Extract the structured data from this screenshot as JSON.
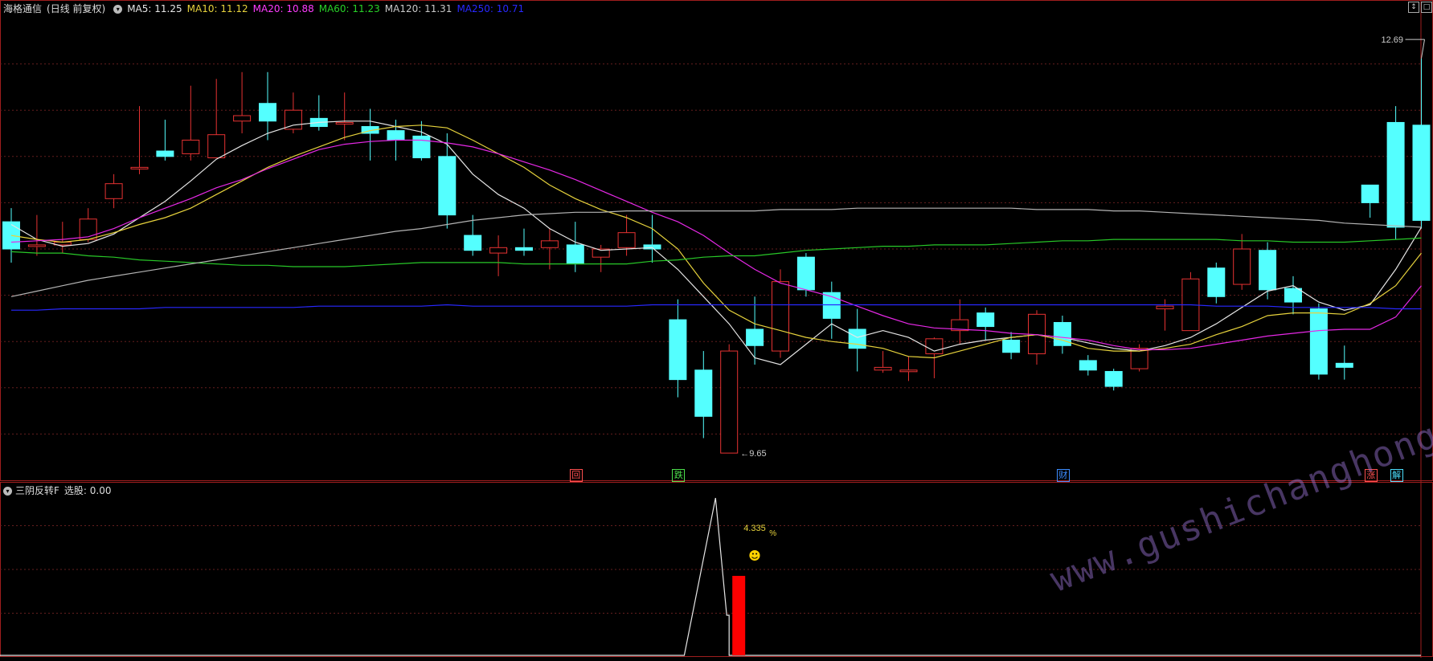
{
  "header": {
    "stock": "海格通信",
    "period": "(日线 前复权)",
    "ma": [
      {
        "label": "MA5: 11.25",
        "color": "#e6e6e6"
      },
      {
        "label": "MA10: 11.12",
        "color": "#e6d23c"
      },
      {
        "label": "MA20: 10.88",
        "color": "#ff3cff"
      },
      {
        "label": "MA60: 11.23",
        "color": "#28d228"
      },
      {
        "label": "MA120: 11.31",
        "color": "#c8c8c8"
      },
      {
        "label": "MA250: 10.71",
        "color": "#2828ff"
      }
    ]
  },
  "price": {
    "max_label": "12.69",
    "min_label": "9.65",
    "ymin": 9.45,
    "ymax": 12.85
  },
  "candles": [
    [
      11.35,
      11.15,
      11.45,
      11.05
    ],
    [
      11.17,
      11.18,
      11.4,
      11.1
    ],
    [
      11.18,
      11.2,
      11.35,
      11.12
    ],
    [
      11.22,
      11.37,
      11.45,
      11.2
    ],
    [
      11.52,
      11.63,
      11.7,
      11.45
    ],
    [
      11.74,
      11.75,
      12.2,
      11.7
    ],
    [
      11.87,
      11.83,
      12.1,
      11.8
    ],
    [
      11.85,
      11.95,
      12.35,
      11.8
    ],
    [
      11.82,
      11.99,
      12.4,
      11.82
    ],
    [
      12.09,
      12.13,
      12.45,
      12.0
    ],
    [
      12.22,
      12.09,
      12.45,
      11.95
    ],
    [
      12.03,
      12.17,
      12.3,
      12.0
    ],
    [
      12.11,
      12.05,
      12.28,
      12.02
    ],
    [
      12.07,
      12.08,
      12.3,
      11.95
    ],
    [
      12.05,
      12.0,
      12.18,
      11.8
    ],
    [
      12.02,
      11.95,
      12.1,
      11.8
    ],
    [
      11.98,
      11.82,
      12.09,
      11.8
    ],
    [
      11.83,
      11.4,
      12.0,
      11.3
    ],
    [
      11.25,
      11.14,
      11.4,
      11.1
    ],
    [
      11.12,
      11.16,
      11.25,
      10.95
    ],
    [
      11.16,
      11.14,
      11.3,
      11.1
    ],
    [
      11.16,
      11.21,
      11.3,
      11.0
    ],
    [
      11.18,
      11.04,
      11.35,
      10.98
    ],
    [
      11.09,
      11.15,
      11.18,
      10.98
    ],
    [
      11.16,
      11.27,
      11.4,
      11.1
    ],
    [
      11.18,
      11.15,
      11.4,
      11.05
    ],
    [
      10.63,
      10.19,
      10.78,
      10.06
    ],
    [
      10.26,
      9.92,
      10.4,
      9.76
    ],
    [
      9.65,
      10.4,
      10.45,
      9.65
    ],
    [
      10.56,
      10.44,
      10.8,
      10.3
    ],
    [
      10.4,
      10.91,
      11.0,
      10.35
    ],
    [
      11.09,
      10.85,
      11.12,
      10.8
    ],
    [
      10.83,
      10.64,
      10.91,
      10.49
    ],
    [
      10.56,
      10.42,
      10.71,
      10.25
    ],
    [
      10.26,
      10.28,
      10.4,
      10.24
    ],
    [
      10.25,
      10.26,
      10.36,
      10.18
    ],
    [
      10.38,
      10.49,
      10.5,
      10.2
    ],
    [
      10.55,
      10.63,
      10.78,
      10.45
    ],
    [
      10.68,
      10.58,
      10.72,
      10.48
    ],
    [
      10.48,
      10.39,
      10.54,
      10.34
    ],
    [
      10.38,
      10.67,
      10.7,
      10.3
    ],
    [
      10.61,
      10.44,
      10.66,
      10.38
    ],
    [
      10.33,
      10.26,
      10.37,
      10.22
    ],
    [
      10.25,
      10.14,
      10.27,
      10.11
    ],
    [
      10.27,
      10.42,
      10.45,
      10.25
    ],
    [
      10.71,
      10.73,
      10.78,
      10.55
    ],
    [
      10.55,
      10.93,
      10.98,
      10.55
    ],
    [
      11.01,
      10.8,
      11.05,
      10.75
    ],
    [
      10.89,
      11.15,
      11.26,
      10.85
    ],
    [
      11.14,
      10.85,
      11.2,
      10.78
    ],
    [
      10.86,
      10.76,
      10.95,
      10.67
    ],
    [
      10.71,
      10.23,
      10.75,
      10.19
    ],
    [
      10.31,
      10.28,
      10.44,
      10.19
    ],
    [
      11.62,
      11.49,
      11.62,
      11.38
    ],
    [
      12.08,
      11.31,
      12.2,
      11.22
    ],
    [
      12.06,
      11.36,
      12.55,
      11.3
    ]
  ],
  "ma_series": {
    "ma5": [
      11.33,
      11.22,
      11.17,
      11.19,
      11.26,
      11.38,
      11.5,
      11.65,
      11.81,
      11.91,
      12.0,
      12.06,
      12.08,
      12.09,
      12.09,
      12.05,
      12.01,
      11.92,
      11.7,
      11.55,
      11.45,
      11.3,
      11.2,
      11.14,
      11.15,
      11.16,
      11.0,
      10.8,
      10.6,
      10.35,
      10.3,
      10.45,
      10.6,
      10.5,
      10.55,
      10.5,
      10.4,
      10.45,
      10.48,
      10.5,
      10.52,
      10.5,
      10.46,
      10.42,
      10.4,
      10.44,
      10.5,
      10.6,
      10.72,
      10.84,
      10.88,
      10.76,
      10.7,
      10.74,
      11.0,
      11.31
    ],
    "ma10": [
      11.25,
      11.22,
      11.2,
      11.22,
      11.27,
      11.33,
      11.38,
      11.45,
      11.55,
      11.65,
      11.75,
      11.83,
      11.9,
      11.97,
      12.02,
      12.05,
      12.06,
      12.04,
      11.95,
      11.85,
      11.75,
      11.62,
      11.52,
      11.44,
      11.38,
      11.3,
      11.15,
      10.9,
      10.7,
      10.6,
      10.55,
      10.5,
      10.47,
      10.45,
      10.42,
      10.36,
      10.35,
      10.4,
      10.45,
      10.5,
      10.52,
      10.48,
      10.42,
      10.4,
      10.4,
      10.42,
      10.45,
      10.52,
      10.58,
      10.66,
      10.68,
      10.68,
      10.67,
      10.75,
      10.88,
      11.12
    ],
    "ma20": [
      11.2,
      11.21,
      11.22,
      11.24,
      11.3,
      11.38,
      11.45,
      11.52,
      11.6,
      11.66,
      11.74,
      11.81,
      11.88,
      11.92,
      11.94,
      11.95,
      11.95,
      11.93,
      11.9,
      11.85,
      11.79,
      11.73,
      11.66,
      11.58,
      11.5,
      11.42,
      11.35,
      11.25,
      11.12,
      11.0,
      10.9,
      10.85,
      10.8,
      10.73,
      10.66,
      10.6,
      10.57,
      10.56,
      10.55,
      10.53,
      10.52,
      10.5,
      10.48,
      10.44,
      10.41,
      10.41,
      10.42,
      10.45,
      10.48,
      10.51,
      10.53,
      10.55,
      10.56,
      10.56,
      10.65,
      10.88
    ],
    "ma60": [
      11.13,
      11.12,
      11.12,
      11.1,
      11.09,
      11.07,
      11.06,
      11.05,
      11.04,
      11.03,
      11.03,
      11.02,
      11.02,
      11.02,
      11.03,
      11.04,
      11.05,
      11.05,
      11.05,
      11.05,
      11.04,
      11.04,
      11.04,
      11.04,
      11.04,
      11.06,
      11.07,
      11.09,
      11.1,
      11.1,
      11.12,
      11.14,
      11.15,
      11.16,
      11.17,
      11.17,
      11.18,
      11.18,
      11.18,
      11.19,
      11.2,
      11.21,
      11.21,
      11.22,
      11.22,
      11.22,
      11.22,
      11.22,
      11.21,
      11.21,
      11.2,
      11.2,
      11.2,
      11.21,
      11.22,
      11.23
    ],
    "ma120": [
      10.8,
      10.84,
      10.88,
      10.92,
      10.95,
      10.98,
      11.01,
      11.04,
      11.07,
      11.1,
      11.13,
      11.16,
      11.19,
      11.22,
      11.25,
      11.28,
      11.3,
      11.33,
      11.36,
      11.38,
      11.4,
      11.41,
      11.42,
      11.42,
      11.43,
      11.43,
      11.43,
      11.43,
      11.43,
      11.43,
      11.44,
      11.44,
      11.44,
      11.45,
      11.45,
      11.45,
      11.45,
      11.45,
      11.45,
      11.45,
      11.44,
      11.44,
      11.44,
      11.43,
      11.43,
      11.42,
      11.41,
      11.4,
      11.39,
      11.38,
      11.37,
      11.36,
      11.34,
      11.33,
      11.32,
      11.31
    ],
    "ma250": [
      10.7,
      10.7,
      10.71,
      10.71,
      10.71,
      10.71,
      10.72,
      10.72,
      10.72,
      10.72,
      10.72,
      10.72,
      10.73,
      10.73,
      10.73,
      10.73,
      10.73,
      10.74,
      10.73,
      10.73,
      10.73,
      10.73,
      10.73,
      10.73,
      10.73,
      10.74,
      10.74,
      10.74,
      10.74,
      10.74,
      10.74,
      10.74,
      10.74,
      10.74,
      10.74,
      10.74,
      10.74,
      10.74,
      10.74,
      10.74,
      10.74,
      10.74,
      10.74,
      10.74,
      10.74,
      10.74,
      10.74,
      10.73,
      10.73,
      10.73,
      10.72,
      10.72,
      10.72,
      10.72,
      10.71,
      10.71
    ]
  },
  "events": [
    {
      "idx": 22,
      "label": "回",
      "color": "#ff5050"
    },
    {
      "idx": 26,
      "label": "跌",
      "color": "#4ce04c"
    },
    {
      "idx": 41,
      "label": "财",
      "color": "#3c8cff"
    },
    {
      "idx": 53,
      "label": "涨",
      "color": "#ff5050"
    },
    {
      "idx": 54,
      "label": "解",
      "color": "#4ce0ff"
    }
  ],
  "indicator": {
    "title": "三阴反转F",
    "value_label": "选股: 0.00",
    "pct_value": "4.335",
    "pct_sign": "%",
    "smiley": "☻"
  },
  "colors": {
    "up": "#e63232",
    "down": "#54ffff",
    "grid": "#641e1e",
    "frame": "#a01e1e"
  },
  "watermark": "www.gushichanghong.com"
}
